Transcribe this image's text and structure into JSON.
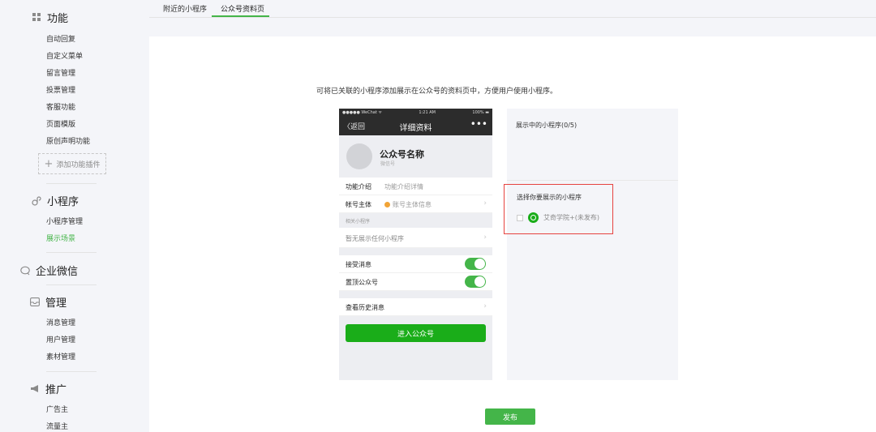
{
  "sidebar": {
    "sections": [
      {
        "title": "功能",
        "icon": "grid-icon"
      },
      {
        "title": "小程序",
        "icon": "link-icon"
      },
      {
        "title": "企业微信",
        "icon": "chat-icon"
      },
      {
        "title": "管理",
        "icon": "inbox-icon"
      },
      {
        "title": "推广",
        "icon": "megaphone-icon"
      }
    ],
    "function_items": [
      "自动回复",
      "自定义菜单",
      "留言管理",
      "投票管理",
      "客服功能",
      "页面模版",
      "原创声明功能"
    ],
    "add_plugin": "添加功能插件",
    "miniprogram_items": [
      "小程序管理",
      "展示场景"
    ],
    "manage_items": [
      "消息管理",
      "用户管理",
      "素材管理"
    ],
    "promo_items": [
      "广告主",
      "流量主"
    ]
  },
  "tabs": [
    "附近的小程序",
    "公众号资料页"
  ],
  "description": "可将已关联的小程序添加展示在公众号的资料页中，方便用户使用小程序。",
  "phone": {
    "status_left": "●●●●● WeChat ᯤ",
    "status_time": "1:21 AM",
    "status_right": "100% ▬",
    "back": "〈返回",
    "title": "详细资料",
    "more": "•••",
    "account_name": "公众号名称",
    "wechat_id": "微信号",
    "rows": [
      {
        "label": "功能介绍",
        "value": "功能介绍详情"
      },
      {
        "label": "帐号主体",
        "value": "账号主体信息"
      }
    ],
    "related_header": "相关小程序",
    "no_miniprogram": "暂无展示任何小程序",
    "toggles": [
      "接受消息",
      "置顶公众号"
    ],
    "history": "查看历史消息",
    "enter_button": "进入公众号"
  },
  "panel": {
    "showing_title": "展示中的小程序(0/5)",
    "select_title": "选择你要展示的小程序",
    "miniprogram_name": "艾奇学院+(未发布)"
  },
  "publish_button": "发布",
  "colors": {
    "accent": "#44b549",
    "highlight_border": "#e64340",
    "wechat_green": "#1aad19"
  }
}
